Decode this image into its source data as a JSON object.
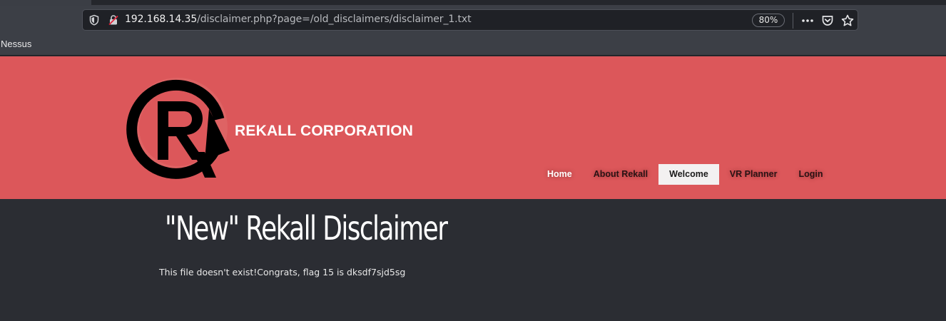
{
  "browser": {
    "url_host": "192.168.14.35",
    "url_path": "/disclaimer.php?page=/old_disclaimers/disclaimer_1.txt",
    "zoom": "80%",
    "bookmarks": [
      "Nessus"
    ]
  },
  "site": {
    "brand": "REKALL CORPORATION",
    "nav": [
      {
        "label": "Home",
        "active": false
      },
      {
        "label": "About Rekall",
        "active": false
      },
      {
        "label": "Welcome",
        "active": true
      },
      {
        "label": "VR Planner",
        "active": false
      },
      {
        "label": "Login",
        "active": false
      }
    ]
  },
  "content": {
    "title": "\"New\" Rekall Disclaimer",
    "message": "This file doesn't exist!Congrats, flag 15 is dksdf7sjd5sg"
  },
  "colors": {
    "header": "#dc575a",
    "content_bg": "#2b2d33",
    "active_tab": "#f3f1f1"
  }
}
